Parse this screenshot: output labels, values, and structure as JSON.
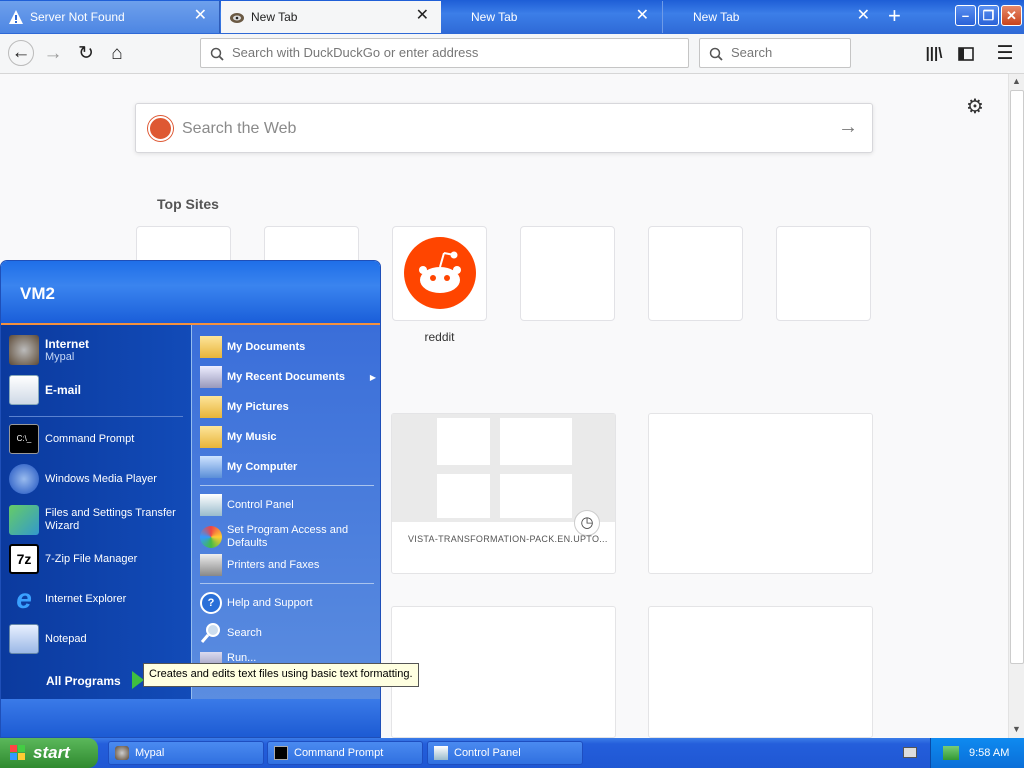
{
  "browser": {
    "tabs": [
      {
        "label": "Server Not Found",
        "icon": "warning-icon",
        "active": false
      },
      {
        "label": "New Tab",
        "icon": "raccoon-icon",
        "active": true
      },
      {
        "label": "New Tab",
        "icon": "",
        "active": false
      },
      {
        "label": "New Tab",
        "icon": "",
        "active": false
      }
    ],
    "url_placeholder": "Search with DuckDuckGo or enter address",
    "search_placeholder": "Search"
  },
  "newtab": {
    "search_placeholder": "Search the Web",
    "top_sites_title": "Top Sites",
    "top_sites": [
      {
        "label": ""
      },
      {
        "label": ""
      },
      {
        "label": "reddit"
      },
      {
        "label": ""
      },
      {
        "label": ""
      },
      {
        "label": ""
      }
    ],
    "highlight_card": {
      "label": "VISTA-TRANSFORMATION-PACK.EN.UPTO..."
    }
  },
  "start_menu": {
    "user": "VM2",
    "pinned": [
      {
        "label": "Internet",
        "sub": "Mypal"
      },
      {
        "label": "E-mail",
        "sub": ""
      }
    ],
    "recent": [
      {
        "label": "Command Prompt"
      },
      {
        "label": "Windows Media Player"
      },
      {
        "label": "Files and Settings Transfer Wizard"
      },
      {
        "label": "7-Zip File Manager"
      },
      {
        "label": "Internet Explorer"
      },
      {
        "label": "Notepad"
      }
    ],
    "all_programs": "All Programs",
    "places": [
      {
        "label": "My Documents"
      },
      {
        "label": "My Recent Documents"
      },
      {
        "label": "My Pictures"
      },
      {
        "label": "My Music"
      },
      {
        "label": "My Computer"
      }
    ],
    "system": [
      {
        "label": "Control Panel"
      },
      {
        "label": "Set Program Access and Defaults"
      },
      {
        "label": "Printers and Faxes"
      }
    ],
    "help": [
      {
        "label": "Help and Support"
      },
      {
        "label": "Search"
      },
      {
        "label": "Run..."
      }
    ],
    "tooltip": "Creates and edits text files using basic text formatting."
  },
  "taskbar": {
    "start_label": "start",
    "buttons": [
      {
        "label": "Mypal"
      },
      {
        "label": "Command Prompt"
      },
      {
        "label": "Control Panel"
      }
    ],
    "clock": "9:58 AM"
  }
}
